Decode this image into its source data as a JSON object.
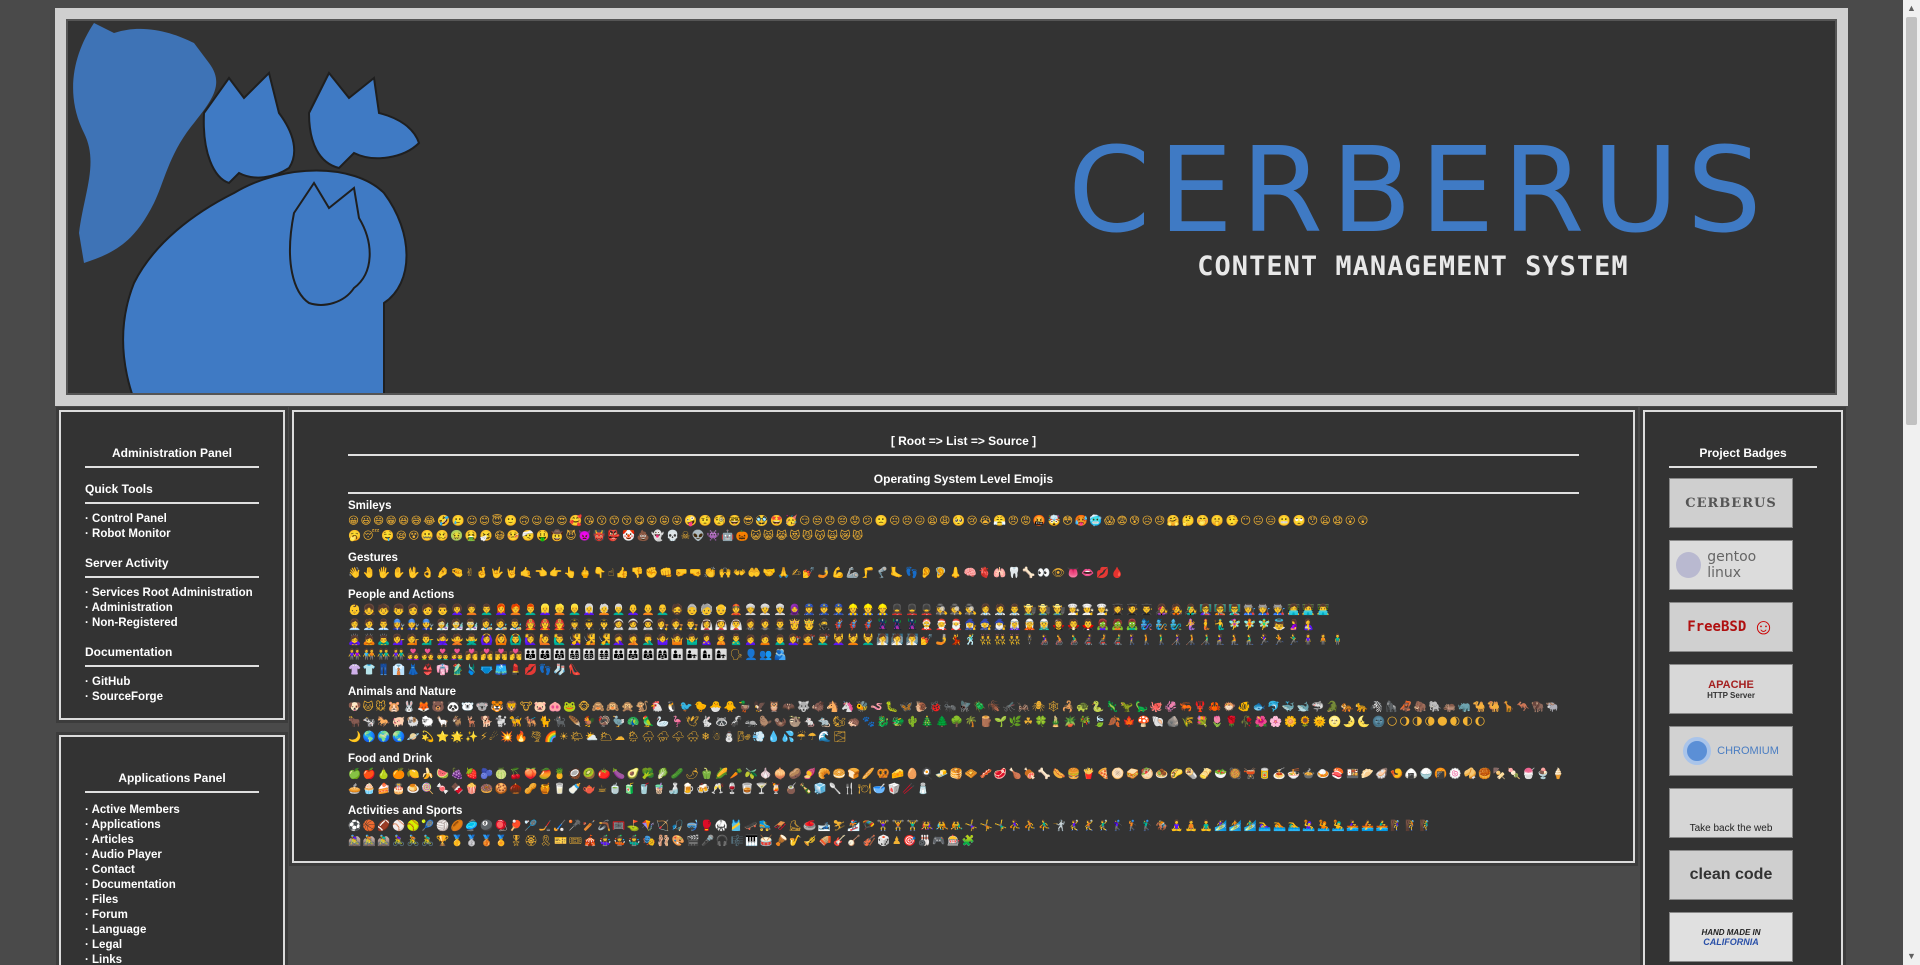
{
  "header": {
    "title": "CERBERUS",
    "subtitle": "CONTENT MANAGEMENT SYSTEM",
    "brand_color": "#3f7ac4"
  },
  "admin_panel": {
    "title": "Administration Panel",
    "sections": [
      {
        "heading": "Quick Tools",
        "items": [
          "Control Panel",
          "Robot Monitor"
        ]
      },
      {
        "heading": "Server Activity",
        "items": [
          "Services Root Administration",
          "Administration",
          "Non-Registered"
        ]
      },
      {
        "heading": "Documentation",
        "items": [
          "GitHub",
          "SourceForge"
        ]
      }
    ]
  },
  "apps_panel": {
    "title": "Applications Panel",
    "items": [
      "Active Members",
      "Applications",
      "Articles",
      "Audio Player",
      "Contact",
      "Documentation",
      "Files",
      "Forum",
      "Language",
      "Legal",
      "Links"
    ]
  },
  "main": {
    "breadcrumb": "[ Root => List => Source ]",
    "title": "Operating System Level Emojis",
    "groups": [
      {
        "name": "Smileys",
        "lines": [
          "😀😃😄😁😆😅😂🤣🥲☺😊😇🙂🙃😉😌😍🥰😘😗😙😚😋😛😝😜🤪🤨🧐🤓😎🥸🤩🥳😏😒😞😔😟😕🙁☹😣😖😫😩🥺😢😭😤😠😡🤬🤯😳🥵🥶😱😨😰😥😓🤗🤔🤭🤫🤥😶😐😑😬🙄😯😦😧😮😲",
          "🥱😴🤤😪😵🤐🥴🤢🤮🤧😷🤒🤕🤑🤠😈👿👹👺🤡💩👻💀☠👽👾🤖🎃😺😸😹😻😼😽🙀😿😾"
        ]
      },
      {
        "name": "Gestures",
        "lines": [
          "👋🤚🖐✋🖖👌🤌🤏✌🤞🤟🤘🤙👈👉👆🖕👇☝👍👎✊👊🤛🤜👏🙌👐🤲🤝🙏✍💅🤳💪🦾🦵🦿🦶👣👂🦻👃🧠🫀🫁🦷🦴👀👁👅👄💋🩸"
        ]
      },
      {
        "name": "People and Actions",
        "lines": [
          "👶👧🧒👦👩🧑👨👩‍🦱🧑‍🦱👨‍🦱👩‍🦰🧑‍🦰👨‍🦰👱‍♀️👱👱‍♂️👩‍🦳🧑‍🦳👨‍🦳👩‍🦲🧑‍🦲👨‍🦲🧔👵🧓👴👲👳‍♀️👳👳‍♂️🧕👮‍♀️👮👮‍♂️👷‍♀️👷👷‍♂️💂‍♀️💂💂‍♂️🕵️‍♀️🕵️🕵️‍♂️👩‍⚕️🧑‍⚕️👨‍⚕️👩‍🌾🧑‍🌾👨‍🌾👩‍🍳🧑‍🍳👨‍🍳👩‍🎓🧑‍🎓👨‍🎓👩‍🎤🧑‍🎤👨‍🎤👩‍🏫🧑‍🏫👨‍🏫👩‍🏭🧑‍🏭👨‍🏭👩‍💻🧑‍💻👨‍💻",
          "👩‍💼🧑‍💼👨‍💼👩‍🔧🧑‍🔧👨‍🔧👩‍🔬🧑‍🔬👨‍🔬👩‍🎨🧑‍🎨👨‍🎨👩‍🚒🧑‍🚒👨‍🚒👩‍✈️🧑‍✈️👨‍✈️👩‍🚀🧑‍🚀👨‍🚀👩‍⚖️🧑‍⚖️👨‍⚖️👰‍♀️👰👰‍♂️🤵‍♀️🤵🤵‍♂️👸🤴🥷🦸‍♀️🦸🦸‍♂️🦹‍♀️🦹🦹‍♂️🤶🧑‍🎄🎅🧙‍♀️🧙🧙‍♂️🧝‍♀️🧝🧝‍♂️🧛‍♀️🧛🧛‍♂️🧟‍♀️🧟🧟‍♂️🧞‍♀️🧞🧞‍♂️🧜‍♀️🧜🧜‍♂️🧚‍♀️🧚🧚‍♂️👼🤰🤱",
          "🙇‍♀️🙇🙇‍♂️💁‍♀️💁💁‍♂️🙅‍♀️🙅🙅‍♂️🙆‍♀️🙆🙆‍♂️🙋‍♀️🙋🙋‍♂️🧏‍♀️🧏🧏‍♂️🤦‍♀️🤦🤦‍♂️🤷‍♀️🤷🤷‍♂️🙎‍♀️🙎🙎‍♂️🙍‍♀️🙍🙍‍♂️💇‍♀️💇💇‍♂️💆‍♀️💆💆‍♂️🧖‍♀️🧖🧖‍♂️💅🤳💃🕺👯‍♀️👯👯‍♂️🕴👩‍🦽🧑‍🦽👨‍🦽👩‍🦼🧑‍🦼👨‍🦼🚶‍♀️🚶🚶‍♂️👩‍🦯🧑‍🦯👨‍🦯🧎‍♀️🧎🧎‍♂️🏃‍♀️🏃🏃‍♂️🧍‍♀️🧍🧍‍♂️",
          "👭🧑‍🤝‍🧑👬👫👩‍❤️‍👩💑👨‍❤️‍👨👩‍❤️‍👨👩‍❤️‍💋‍👩💏👨‍❤️‍💋‍👨👩‍❤️‍💋‍👨👪👨‍👩‍👦👨‍👩‍👧👨‍👩‍👧‍👦👨‍👩‍👦‍👦👨‍👩‍👧‍👧👨‍👨‍👦👨‍👨‍👧👩‍👩‍👦👩‍👩‍👧👨‍👦👨‍👧👩‍👦👩‍👧🗣👤👥🫂",
          "👚👕👖👔👗👙👘🥻🩱🩲🩳💄💋👣🧦👠"
        ]
      },
      {
        "name": "Animals and Nature",
        "lines": [
          "🐶🐱🐭🐹🐰🦊🐻🐼🐻‍❄️🐨🐯🦁🐮🐷🐽🐸🐵🙈🙉🙊🐒🐔🐧🐦🐤🐣🐥🦆🦅🦉🦇🐺🐗🐴🦄🐝🪱🐛🦋🐌🐞🐜🪰🪲🪳🦟🦗🕷🕸🦂🐢🐍🦎🦖🦕🐙🦑🦐🦞🦀🐡🐠🐟🐬🐳🐋🦈🐊🐅🐆🦓🦍🦧🦣🐘🦛🦏🐪🐫🦒🦘🦬🐃",
          "🐂🐄🐎🐖🐏🐑🦙🐐🦌🐕🐩🦮🐕‍🦺🐈🐈‍⬛🪶🐓🦃🦤🦚🦜🦢🦩🕊🐇🦝🦨🦡🦫🦦🦥🐁🐀🐿🦔🐾🐉🐲🌵🎄🌲🌳🌴🪵🌱🌿☘🍀🎍🪴🎋🍃🍂🍁🍄🐚🪨🌾💐🌷🌹🥀🌺🌸🌼🌻🌞🌝🌛🌜🌚🌕🌖🌗🌘🌑🌒🌓🌔",
          "🌙🌎🌍🌏🪐💫⭐🌟✨⚡☄💥🔥🌪🌈☀🌤⛅🌥☁🌦🌧⛈🌩🌨❄☃⛄🌬💨💧💦☔☂🌊🌫"
        ]
      },
      {
        "name": "Food and Drink",
        "lines": [
          "🍏🍎🍐🍊🍋🍌🍉🍇🍓🫐🍈🍒🍑🥭🍍🥥🥝🍅🍆🥑🥦🥬🥒🌶🫑🌽🥕🫒🧄🧅🥔🍠🥐🥯🍞🥖🥨🧀🥚🍳🧈🥞🧇🥓🥩🍗🍖🦴🌭🍔🍟🍕🫓🥪🥙🧆🌮🌯🫔🥗🥘🫕🥫🍝🍜🍲🍛🍣🍱🥟🦪🍤🍙🍚🍘🍥🥠🥮🍢🍡🍧🍨🍦",
          "🥧🧁🍰🎂🍮🍭🍬🍫🍿🍩🍪🌰🥜🍯🥛🍼🫖☕🍵🧃🥤🧋🍶🍺🍻🥂🍷🥃🍸🍹🧉🍾🧊🥄🍴🍽🥣🥡🥢🧂"
        ]
      },
      {
        "name": "Activities and Sports",
        "lines": [
          "⚽🏀🏈⚾🥎🎾🏐🏉🥏🎱🪀🏓🏸🏒🏑🥍🏏🪃🥅⛳🪁🏹🎣🤿🥊🥋🎽🛹🛼🛷⛸🥌🎿⛷🏂🪂🏋️‍♀️🏋️🏋️‍♂️🤼‍♀️🤼🤼‍♂️🤸‍♀️🤸🤸‍♂️⛹️‍♀️⛹️⛹️‍♂️🤺🤾‍♀️🤾🤾‍♂️🏌️‍♀️🏌️🏌️‍♂️🏇🧘‍♀️🧘🧘‍♂️🏄‍♀️🏄🏄‍♂️🏊‍♀️🏊🏊‍♂️🤽‍♀️🤽🤽‍♂️🚣‍♀️🚣🚣‍♂️🧗‍♀️🧗🧗‍♂️",
          "🚵‍♀️🚵🚵‍♂️🚴‍♀️🚴🚴‍♂️🏆🥇🥈🥉🏅🎖🏵🎗🎫🎟🎪🤹‍♀️🤹🤹‍♂️🎭🩰🎨🎬🎤🎧🎼🎹🥁🪘🎷🎺🪗🎸🪕🎻🎲♟🎯🎳🎮🎰🧩"
        ]
      }
    ]
  },
  "badges_panel": {
    "title": "Project Badges",
    "badges": [
      {
        "label": "CERBERUS",
        "icon": "cerberus-badge"
      },
      {
        "label": "gentoo linux",
        "icon": "gentoo-badge"
      },
      {
        "label": "FreeBSD",
        "icon": "freebsd-badge"
      },
      {
        "label": "APACHE",
        "sub": "HTTP Server",
        "icon": "apache-badge"
      },
      {
        "label": "CHROMIUM",
        "icon": "chromium-badge"
      },
      {
        "label": "Take back the web",
        "icon": "firefox-badge"
      },
      {
        "label": "clean code",
        "icon": "clean-code-badge"
      },
      {
        "label": "HAND MADE IN",
        "sub": "CALIFORNIA",
        "icon": "california-badge"
      }
    ]
  }
}
